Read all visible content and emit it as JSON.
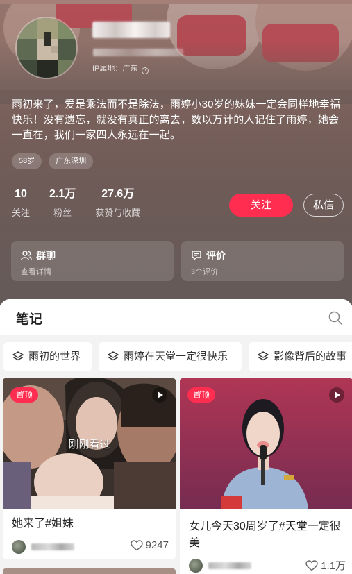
{
  "profile": {
    "ip_location": "IP属地：广东",
    "bio": "雨初来了，爱是乘法而不是除法，雨婷小30岁的妹妹一定会同样地幸福快乐！没有遗忘，就没有真正的离去，数以万计的人记住了雨婷，她会一直在，我们一家四人永远在一起。",
    "tags": [
      "58岁",
      "广东深圳"
    ],
    "stats": [
      {
        "value": "10",
        "label": "关注"
      },
      {
        "value": "2.1万",
        "label": "粉丝"
      },
      {
        "value": "27.6万",
        "label": "获赞与收藏"
      }
    ],
    "follow_label": "关注",
    "message_label": "私信"
  },
  "cards": [
    {
      "title": "群聊",
      "subtitle": "查看详情",
      "icon": "group-icon"
    },
    {
      "title": "评价",
      "subtitle": "3个评价",
      "icon": "comment-icon"
    }
  ],
  "notes_section": {
    "title": "笔记",
    "albums": [
      "雨初的世界",
      "雨婷在天堂一定很快乐",
      "影像背后的故事"
    ]
  },
  "notes": [
    {
      "pin_label": "置顶",
      "overlay": "刚刚看过",
      "title": "她来了#姐妹",
      "likes": "9247"
    },
    {
      "pin_label": "置顶",
      "overlay": "",
      "title": "女儿今天30周岁了#天堂一定很美",
      "likes": "1.1万"
    }
  ],
  "colors": {
    "accent": "#ff2d4f",
    "header_bg": "#7a615b"
  }
}
